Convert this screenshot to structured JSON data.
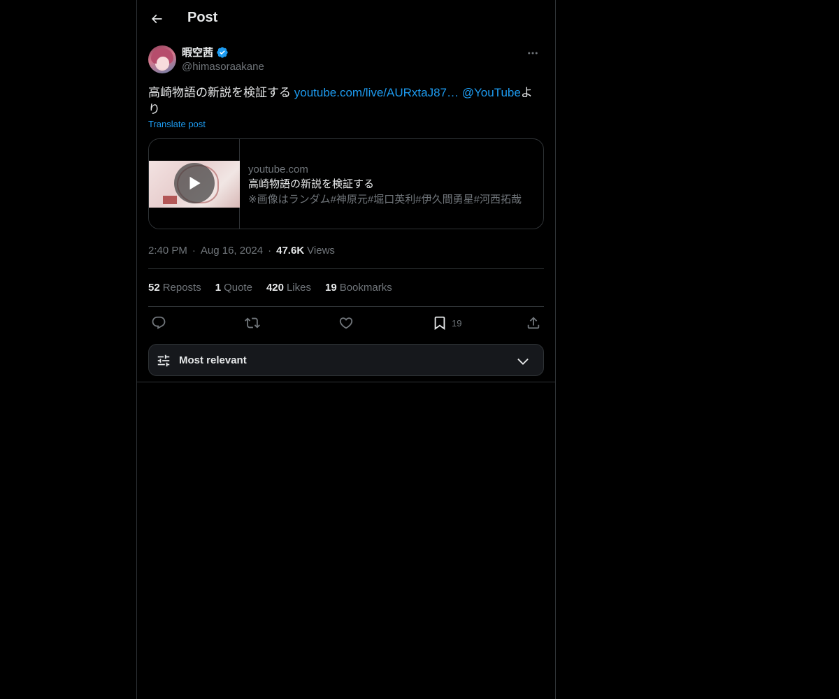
{
  "header": {
    "title": "Post",
    "back_icon": "arrow-left-icon"
  },
  "post": {
    "author": {
      "display_name": "暇空茜",
      "handle": "@himasoraakane",
      "verified": true
    },
    "text": {
      "main": "高崎物語の新説を検証する ",
      "link": "youtube.com/live/AURxtaJ87…",
      "mention": "@YouTube",
      "suffix": "より"
    },
    "translate_label": "Translate post",
    "card": {
      "domain": "youtube.com",
      "title": "高崎物語の新説を検証する",
      "description": "※画像はランダム#神原元#堀口英利#伊久間勇星#河西拓哉"
    },
    "meta": {
      "time": "2:40 PM",
      "date": "Aug 16, 2024",
      "views_count": "47.6K",
      "views_label": "Views"
    },
    "stats": [
      {
        "count": "52",
        "label": "Reposts"
      },
      {
        "count": "1",
        "label": "Quote"
      },
      {
        "count": "420",
        "label": "Likes"
      },
      {
        "count": "19",
        "label": "Bookmarks"
      }
    ],
    "actions": {
      "reply_icon": "reply-icon",
      "repost_icon": "repost-icon",
      "like_icon": "heart-icon",
      "bookmark_icon": "bookmark-icon",
      "bookmark_count": "19",
      "share_icon": "share-icon"
    }
  },
  "sort": {
    "label": "Most relevant"
  },
  "colors": {
    "background": "#000000",
    "accent": "#1d9bf0",
    "text": "#e7e9ea",
    "muted": "#71767b",
    "border": "#2f3336"
  }
}
